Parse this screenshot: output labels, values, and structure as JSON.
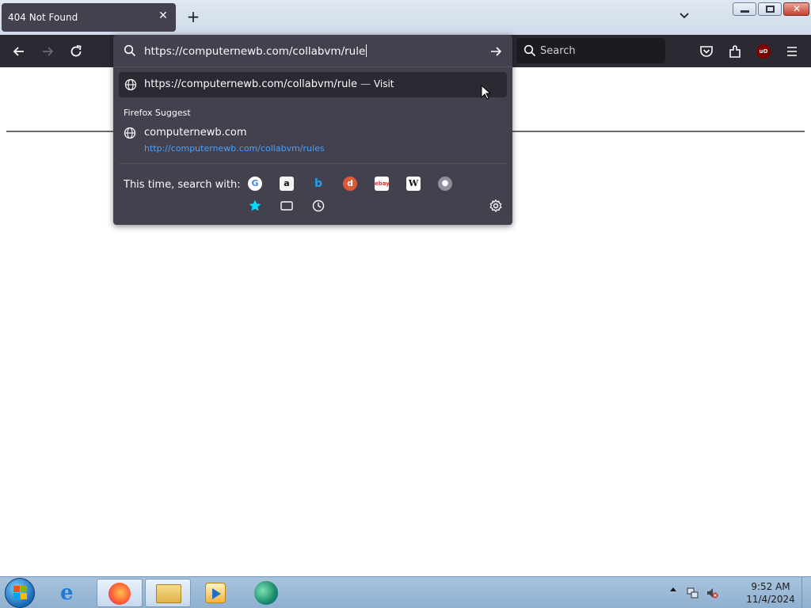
{
  "tab": {
    "title": "404 Not Found"
  },
  "urlbar": {
    "value": "https://computernewb.com/collabvm/rule"
  },
  "search": {
    "placeholder": "Search"
  },
  "results": {
    "first": {
      "url": "https://computernewb.com/collabvm/rule",
      "separator": "—",
      "action": "Visit"
    },
    "group_label": "Firefox Suggest",
    "suggestion": {
      "title": "computernewb.com",
      "url": "http://computernewb.com/collabvm/rules"
    },
    "search_with_label": "This time, search with:",
    "engines": [
      "google-icon",
      "amazon-icon",
      "bing-icon",
      "duckduckgo-icon",
      "ebay-icon",
      "wikipedia-icon",
      "search-engine-icon",
      "bookmarks-icon",
      "tabs-icon",
      "history-icon"
    ]
  },
  "taskbar": {
    "time": "9:52 AM",
    "date": "11/4/2024"
  },
  "colors": {
    "toolbar": "#2b2a33",
    "popup": "#42414d",
    "link": "#45a1ff",
    "accent": "#00ddff"
  }
}
